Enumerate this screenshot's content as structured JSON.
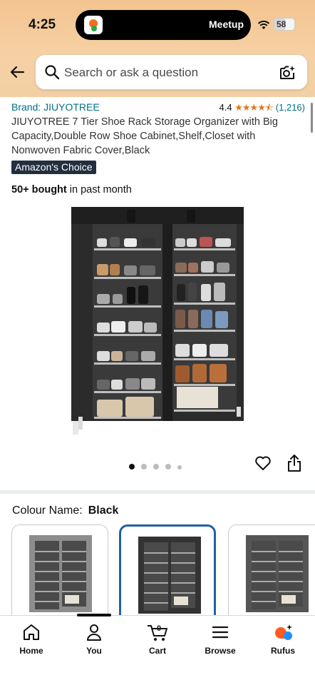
{
  "status_bar": {
    "time": "4:25",
    "live_activity": "Meetup",
    "battery": "58"
  },
  "search": {
    "placeholder": "Search or ask a question"
  },
  "product": {
    "brand": "Brand: JIUYOTREE",
    "rating_value": "4.4",
    "stars": "★★★★⯪",
    "rating_count": "(1,216)",
    "title": "JIUYOTREE 7 Tier Shoe Rack Storage Organizer with Big Capacity,Double Row Shoe Cabinet,Shelf,Closet with Nonwoven Fabric Cover,Black",
    "badge": "Amazon's Choice",
    "bought_bold": "50+ bought",
    "bought_rest": " in past month",
    "image_count": 5,
    "active_image": 1
  },
  "variants": {
    "label": "Colour Name:",
    "selected": "Black",
    "options": [
      {
        "name": "Grey",
        "color": "#8d8d8d"
      },
      {
        "name": "Black",
        "color": "#333333"
      },
      {
        "name": "Dark Grey",
        "color": "#555555"
      }
    ]
  },
  "colors": {
    "accent": "#007185",
    "star": "#de7921",
    "badge_bg": "#232f3e",
    "header_bg": "#f3c48f",
    "selected_border": "#2162a1",
    "rufus": "#ff5a1f"
  },
  "bottom_nav": [
    {
      "label": "Home",
      "icon": "home-icon"
    },
    {
      "label": "You",
      "icon": "user-icon"
    },
    {
      "label": "Cart",
      "icon": "cart-icon",
      "count": "0"
    },
    {
      "label": "Browse",
      "icon": "menu-icon"
    },
    {
      "label": "Rufus",
      "icon": "rufus-icon"
    }
  ]
}
